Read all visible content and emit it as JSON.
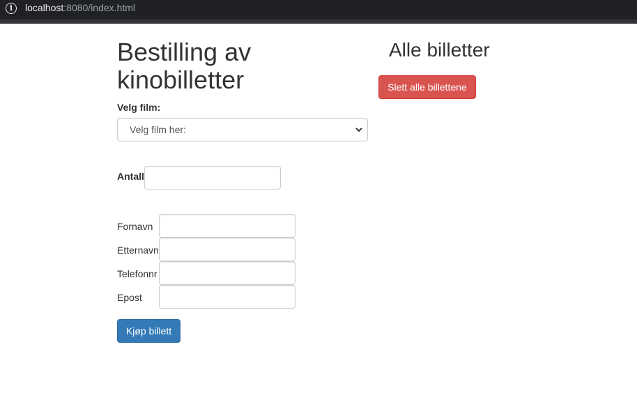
{
  "browser": {
    "url_host": "localhost",
    "url_rest": ":8080/index.html"
  },
  "form": {
    "title": "Bestilling av kinobilletter",
    "film_label": "Velg film:",
    "film_select_value": "Velg film her:",
    "antall_label": "Antall",
    "fields": {
      "fornavn": "Fornavn",
      "etternavn": "Etternavn",
      "telefonnr": "Telefonnr",
      "epost": "Epost"
    },
    "submit_label": "Kjøp billett"
  },
  "tickets": {
    "title": "Alle billetter",
    "delete_all_label": "Slett alle billettene"
  },
  "colors": {
    "primary": "#337ab7",
    "danger": "#d9534f"
  }
}
